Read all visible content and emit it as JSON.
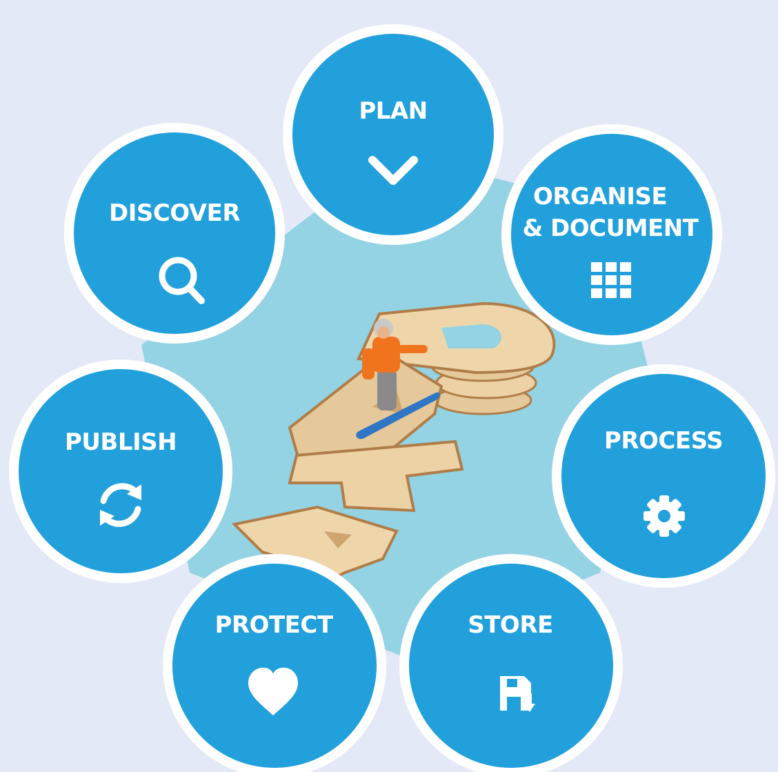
{
  "diagram": {
    "center": {
      "letters": [
        "D",
        "A",
        "T",
        "A"
      ],
      "description": ""
    },
    "nodes": [
      {
        "id": "plan",
        "lines": [
          "PLAN"
        ],
        "icon": "chevron-down-icon"
      },
      {
        "id": "organise",
        "lines": [
          "ORGANISE",
          "& DOCUMENT"
        ],
        "icon": "grid-icon"
      },
      {
        "id": "process",
        "lines": [
          "PROCESS"
        ],
        "icon": "gear-icon"
      },
      {
        "id": "store",
        "lines": [
          "STORE"
        ],
        "icon": "save-file-icon"
      },
      {
        "id": "protect",
        "lines": [
          "PROTECT"
        ],
        "icon": "heart-icon"
      },
      {
        "id": "publish",
        "lines": [
          "PUBLISH"
        ],
        "icon": "refresh-icon"
      },
      {
        "id": "discover",
        "lines": [
          "DISCOVER"
        ],
        "icon": "search-icon"
      }
    ]
  },
  "colors": {
    "background": "#e3e9f6",
    "node_fill": "#21a0dc",
    "node_border": "#ffffff",
    "hub_fill": "#93d3e3",
    "icon": "#ffffff",
    "wood": "#e6c99b",
    "wood_edge": "#b07d48",
    "snowboarder_jacket": "#f0741e",
    "snowboard": "#2f76c5"
  }
}
